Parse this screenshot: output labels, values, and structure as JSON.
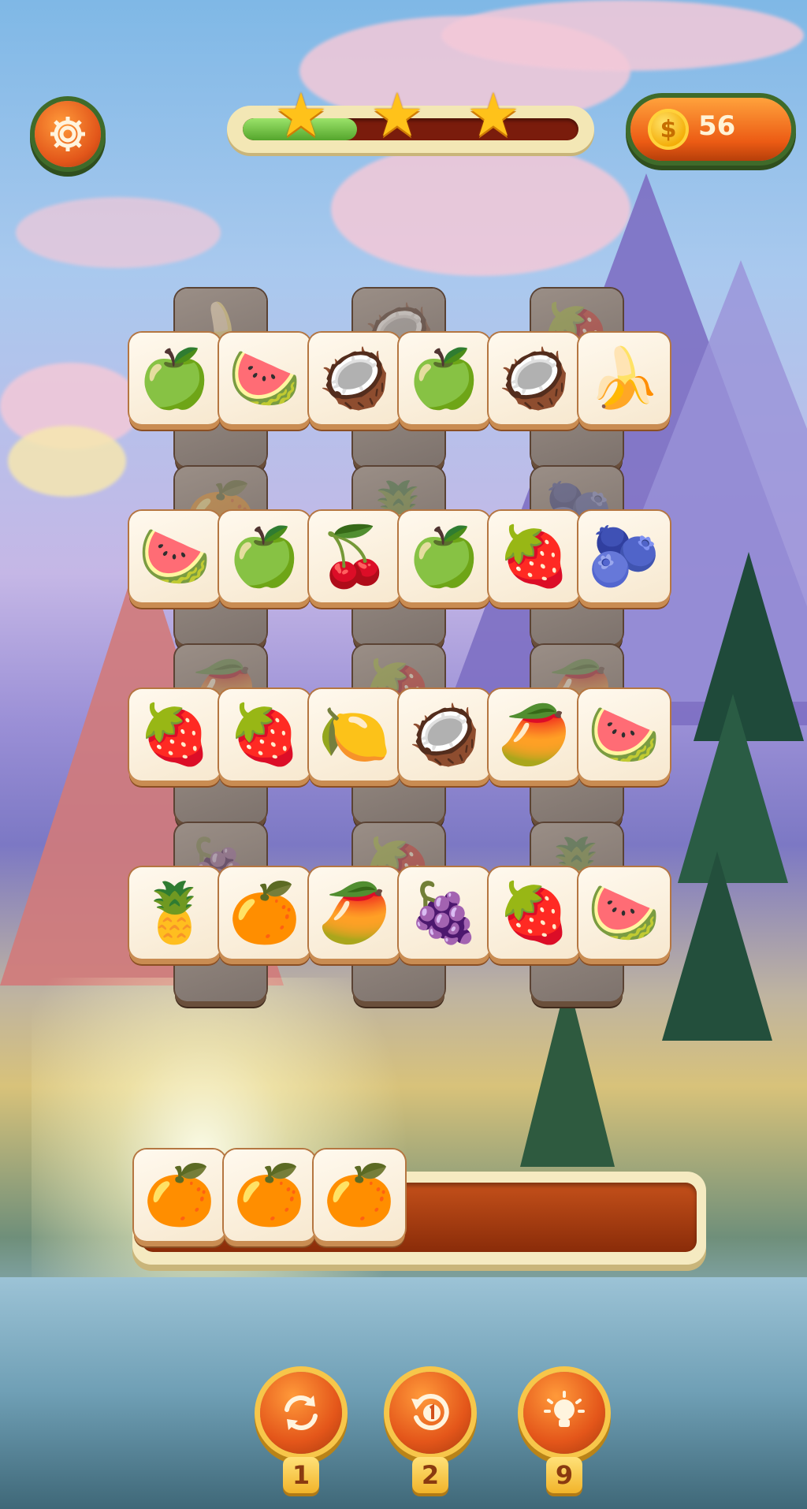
{
  "hud": {
    "settings_icon": "gear-icon",
    "progress_fraction": 0.34,
    "stars": 3,
    "coins": "56",
    "coin_icon": "dollar-coin-icon",
    "coin_symbol": "$"
  },
  "board": {
    "back_tiles": [
      [
        "🍌",
        "🥥",
        "🍓"
      ],
      [
        "🍊",
        "🍍",
        "🫐"
      ],
      [
        "🥭",
        "🍓",
        "🥭"
      ],
      [
        "🍇",
        "🍓",
        "🍍"
      ]
    ],
    "rows": [
      [
        "🍏",
        "🍉",
        "🥥",
        "🍏",
        "🥥",
        "🍌"
      ],
      [
        "🍉",
        "🍏",
        "🍒",
        "🍏",
        "🍓",
        "🫐"
      ],
      [
        "🍓",
        "🍓",
        "🍋",
        "🥥",
        "🥭",
        "🍉"
      ],
      [
        "🍍",
        "🍊",
        "🥭",
        "🍇",
        "🍓",
        "🍉"
      ]
    ]
  },
  "tray": {
    "tiles": [
      "🍊",
      "🍊",
      "🍊"
    ]
  },
  "powerups": [
    {
      "name": "shuffle",
      "icon": "shuffle-icon",
      "count": "1"
    },
    {
      "name": "undo",
      "icon": "undo-icon",
      "count": "2"
    },
    {
      "name": "hint",
      "icon": "lightbulb-icon",
      "count": "9"
    }
  ],
  "colors": {
    "accent_orange": "#ec5b14",
    "progress_green": "#54a52c",
    "star_gold": "#ffc21a"
  }
}
